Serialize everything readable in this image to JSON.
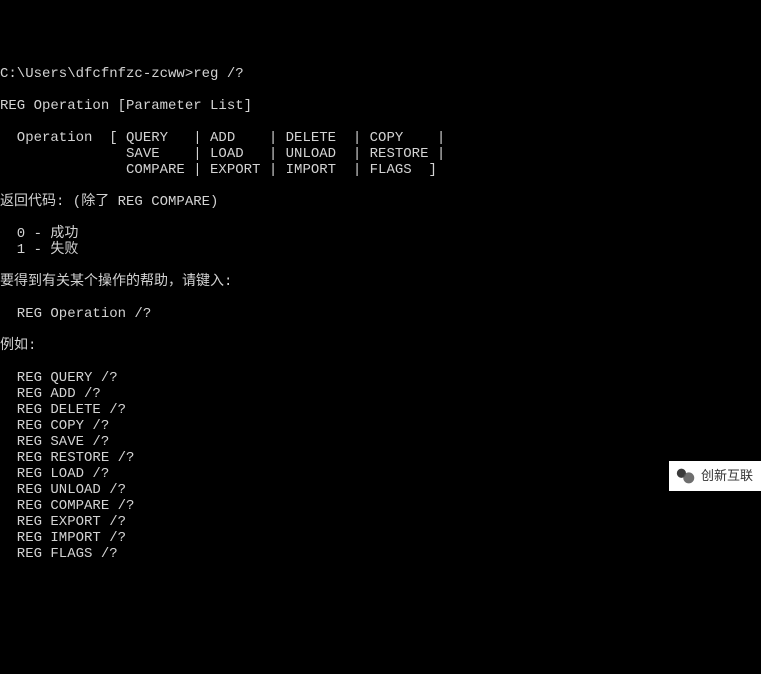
{
  "prompt": {
    "path": "C:\\Users\\dfcfnfzc-zcww>",
    "command": "reg /?"
  },
  "lines": {
    "l1": "REG Operation [Parameter List]",
    "l2": "  Operation  [ QUERY   | ADD    | DELETE  | COPY    |",
    "l3": "               SAVE    | LOAD   | UNLOAD  | RESTORE |",
    "l4": "               COMPARE | EXPORT | IMPORT  | FLAGS  ]",
    "l5": "返回代码: (除了 REG COMPARE)",
    "l6": "  0 - 成功",
    "l7": "  1 - 失败",
    "l8": "要得到有关某个操作的帮助，请键入:",
    "l9": "  REG Operation /?",
    "l10": "例如:",
    "l11": "  REG QUERY /?",
    "l12": "  REG ADD /?",
    "l13": "  REG DELETE /?",
    "l14": "  REG COPY /?",
    "l15": "  REG SAVE /?",
    "l16": "  REG RESTORE /?",
    "l17": "  REG LOAD /?",
    "l18": "  REG UNLOAD /?",
    "l19": "  REG COMPARE /?",
    "l20": "  REG EXPORT /?",
    "l21": "  REG IMPORT /?",
    "l22": "  REG FLAGS /?"
  },
  "watermark": {
    "text": "创新互联"
  }
}
